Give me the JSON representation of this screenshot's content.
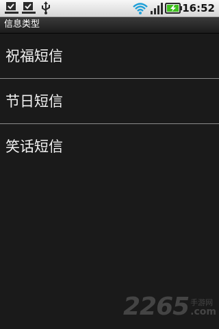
{
  "status_bar": {
    "icons": [
      "download-complete-icon",
      "download-complete-icon",
      "usb-icon",
      "wifi-icon",
      "signal-icon",
      "battery-charging-icon"
    ],
    "time": "16:52",
    "battery_color": "#3fbf1f"
  },
  "title_bar": {
    "title": "信息类型"
  },
  "list": {
    "items": [
      {
        "label": "祝福短信"
      },
      {
        "label": "节日短信"
      },
      {
        "label": "笑话短信"
      }
    ]
  },
  "watermark": {
    "main": "2265",
    "side_top": "手游网",
    "side_bottom": ".com"
  },
  "colors": {
    "background": "#1a1a1a",
    "text": "#f2f2f2",
    "divider": "#8c8c8c"
  }
}
